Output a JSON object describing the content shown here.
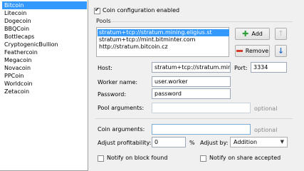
{
  "coins": [
    "Bitcoin",
    "Litecoin",
    "Dogecoin",
    "BBQCoin",
    "Bottlecaps",
    "CryptogenicBullion",
    "Feathercoin",
    "Megacoin",
    "Novacoin",
    "PPCoin",
    "Worldcoin",
    "Zetacoin"
  ],
  "coin_enabled": {
    "label": "Coin configuration enabled",
    "checked": true
  },
  "pools_label": "Pools",
  "pools": [
    "stratum+tcp://stratum.mining.eligius.st",
    "stratum+tcp://mint.bitminter.com",
    "http://stratum.bitcoin.cz"
  ],
  "buttons": {
    "add": "Add",
    "remove": "Remove"
  },
  "fields": {
    "host_label": "Host:",
    "host_value": "stratum+tcp://stratum.mining.eligius.st",
    "port_label": "Port:",
    "port_value": "3334",
    "worker_label": "Worker name:",
    "worker_value": "user.worker",
    "password_label": "Password:",
    "password_value": "password",
    "pool_args_label": "Pool arguments:",
    "pool_args_value": "",
    "pool_args_hint": "optional",
    "coin_args_label": "Coin arguments:",
    "coin_args_value": "",
    "coin_args_hint": "optional",
    "profit_label": "Adjust profitability:",
    "profit_value": "0",
    "profit_unit": "%",
    "adjust_by_label": "Adjust by:",
    "adjust_by_value": "Addition"
  },
  "notify_block": "Notify on block found",
  "notify_share": "Notify on share accepted"
}
